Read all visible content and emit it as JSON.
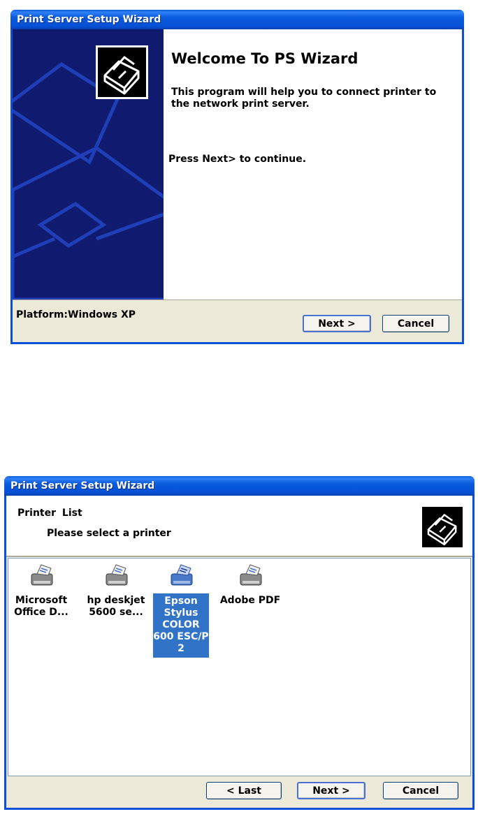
{
  "welcome_window": {
    "title": "Print Server Setup Wizard",
    "heading": "Welcome To PS Wizard",
    "description": "This program will help you to connect printer to the network print server.",
    "instruction": "Press Next> to continue.",
    "platform": "Platform:Windows XP",
    "next_label": "Next >",
    "cancel_label": "Cancel"
  },
  "printer_window": {
    "title": "Print Server Setup Wizard",
    "header_title": "Printer List",
    "header_subtitle": "Please select a printer",
    "printers": [
      {
        "label": "Microsoft Office D...",
        "selected": false
      },
      {
        "label": "hp deskjet 5600 se...",
        "selected": false
      },
      {
        "label": "Epson Stylus COLOR 600 ESC/P 2",
        "selected": true
      },
      {
        "label": "Adobe PDF",
        "selected": false
      }
    ],
    "last_label": "< Last",
    "next_label": "Next >",
    "cancel_label": "Cancel"
  },
  "colors": {
    "titlebar": "#0a5bdc",
    "panel": "#101a6e",
    "selection": "#3173c6",
    "dialog_bg": "#ece9d8"
  }
}
